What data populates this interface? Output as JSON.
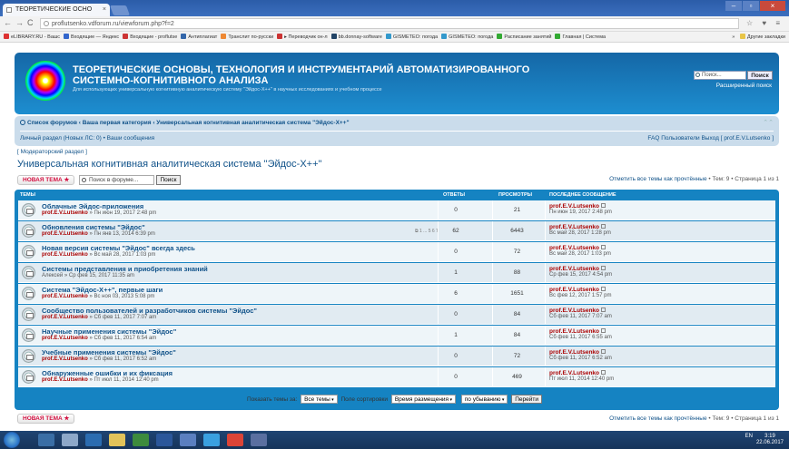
{
  "browser": {
    "tab_title": "ТЕОРЕТИЧЕСКИЕ ОСНО",
    "tab_close": "×",
    "url": "proflutsenko.vdforum.ru/viewforum.php?f=2",
    "back": "←",
    "forward": "→",
    "reload": "C",
    "toolbar_icons": "☆ ♥ ≡",
    "bookmarks": [
      {
        "label": "eLIBRARY.RU - Вашс",
        "color": "#d33"
      },
      {
        "label": "Входящие — Яндекс",
        "color": "#36c"
      },
      {
        "label": "Входящие - proflutse",
        "color": "#c33"
      },
      {
        "label": "Антиплагиат",
        "color": "#36a"
      },
      {
        "label": "Транслит по-русски",
        "color": "#e83"
      },
      {
        "label": "▸ Переводчик он-л",
        "color": "#c33"
      },
      {
        "label": "bb.donnay-software",
        "color": "#246"
      },
      {
        "label": "GISMETEO: погода",
        "color": "#39c"
      },
      {
        "label": "GISMETEO: погода",
        "color": "#39c"
      },
      {
        "label": "Расписание занятий",
        "color": "#3a3"
      },
      {
        "label": "Главная | Система",
        "color": "#3a3"
      }
    ],
    "bookmarks_more": "»",
    "other_bookmarks": "Другие закладки"
  },
  "header": {
    "title": "ТЕОРЕТИЧЕСКИЕ ОСНОВЫ, ТЕХНОЛОГИЯ И ИНСТРУМЕНТАРИЙ АВТОМАТИЗИРОВАННОГО СИСТЕМНО-КОГНИТИВНОГО АНАЛИЗА",
    "description": "Для использующих универсальную когнитивную аналитическую систему \"Эйдос-Х++\" в научных исследованиях и учебном процессе",
    "search_placeholder": "Поиск...",
    "search_button": "Поиск",
    "advanced_search": "Расширенный поиск"
  },
  "nav": {
    "breadcrumb": "Список форумов ‹ Ваша первая категория ‹ Универсальная когнитивная аналитическая система \"Эйдос-Х++\"",
    "collapse": "⌃⌃",
    "personal": "Личный раздел (Новых ЛС: 0) • Ваши сообщения",
    "right": "FAQ  Пользователи  Выход [ prof.E.V.Lutsenko ]"
  },
  "moderator_link": "[ Модераторский раздел ]",
  "forum_title": "Универсальная когнитивная аналитическая система \"Эйдос-Х++\"",
  "actions": {
    "new_topic": "НОВАЯ ТЕМА ★",
    "search_placeholder": "Поиск в форуме...",
    "search_button": "Поиск",
    "mark_read": "Отметить все темы как прочтённые",
    "stats": " • Тем: 9 • Страница 1 из 1"
  },
  "table": {
    "headers": {
      "topics": "ТЕМЫ",
      "replies": "ОТВЕТЫ",
      "views": "ПРОСМОТРЫ",
      "last": "ПОСЛЕДНЕЕ СООБЩЕНИЕ"
    },
    "rows": [
      {
        "title": "Облачные Эйдос-приложения",
        "author": "prof.E.V.Lutsenko",
        "date": " » Пн июн 19, 2017 2:48 pm",
        "pages": "",
        "replies": "0",
        "views": "21",
        "last_author": "prof.E.V.Lutsenko",
        "last_date": "Пн июн 19, 2017 2:48 pm"
      },
      {
        "title": "Обновления системы \"Эйдос\"",
        "author": "prof.E.V.Lutsenko",
        "date": " » Пн янв 13, 2014 6:39 pm",
        "pages": "1 ... 5 6 7",
        "replies": "62",
        "views": "6443",
        "last_author": "prof.E.V.Lutsenko",
        "last_date": "Вс май 28, 2017 1:28 pm"
      },
      {
        "title": "Новая версия системы \"Эйдос\" всегда здесь",
        "author": "prof.E.V.Lutsenko",
        "date": " » Вс май 28, 2017 1:03 pm",
        "pages": "",
        "replies": "0",
        "views": "72",
        "last_author": "prof.E.V.Lutsenko",
        "last_date": "Вс май 28, 2017 1:03 pm"
      },
      {
        "title": "Системы представления и приобретения знаний",
        "author": "Алексей",
        "date": " » Ср фев 15, 2017 11:35 am",
        "pages": "",
        "replies": "1",
        "views": "88",
        "last_author": "prof.E.V.Lutsenko",
        "last_date": "Ср фев 15, 2017 4:54 pm"
      },
      {
        "title": "Система \"Эйдос-Х++\", первые шаги",
        "author": "prof.E.V.Lutsenko",
        "date": " » Вс ноя 03, 2013 5:08 pm",
        "pages": "",
        "replies": "6",
        "views": "1651",
        "last_author": "prof.E.V.Lutsenko",
        "last_date": "Вс фев 12, 2017 1:57 pm"
      },
      {
        "title": "Сообщество пользователей и разработчиков системы \"Эйдос\"",
        "author": "prof.E.V.Lutsenko",
        "date": " » Сб фев 11, 2017 7:07 am",
        "pages": "",
        "replies": "0",
        "views": "84",
        "last_author": "prof.E.V.Lutsenko",
        "last_date": "Сб фев 11, 2017 7:07 am"
      },
      {
        "title": "Научные применения системы \"Эйдос\"",
        "author": "prof.E.V.Lutsenko",
        "date": " » Сб фев 11, 2017 6:54 am",
        "pages": "",
        "replies": "1",
        "views": "84",
        "last_author": "prof.E.V.Lutsenko",
        "last_date": "Сб фев 11, 2017 6:55 am"
      },
      {
        "title": "Учебные применения системы \"Эйдос\"",
        "author": "prof.E.V.Lutsenko",
        "date": " » Сб фев 11, 2017 6:52 am",
        "pages": "",
        "replies": "0",
        "views": "72",
        "last_author": "prof.E.V.Lutsenko",
        "last_date": "Сб фев 11, 2017 6:52 am"
      },
      {
        "title": "Обнаруженные ошибки и их фиксация",
        "author": "prof.E.V.Lutsenko",
        "date": " » Пт июл 11, 2014 12:40 pm",
        "pages": "",
        "replies": "0",
        "views": "469",
        "last_author": "prof.E.V.Lutsenko",
        "last_date": "Пт июл 11, 2014 12:40 pm"
      }
    ]
  },
  "sort": {
    "show_label": "Показать темы за:",
    "show_value": "Все темы",
    "field_label": "Поле сортировки",
    "field_value": "Время размещения",
    "order_value": "по убыванию",
    "go": "Перейти"
  },
  "taskbar": {
    "lang": "EN",
    "time": "3:19",
    "date": "22.06.2017"
  },
  "colors": {
    "accent": "#105289",
    "header": "#1583c2",
    "new_topic": "#d31141"
  }
}
